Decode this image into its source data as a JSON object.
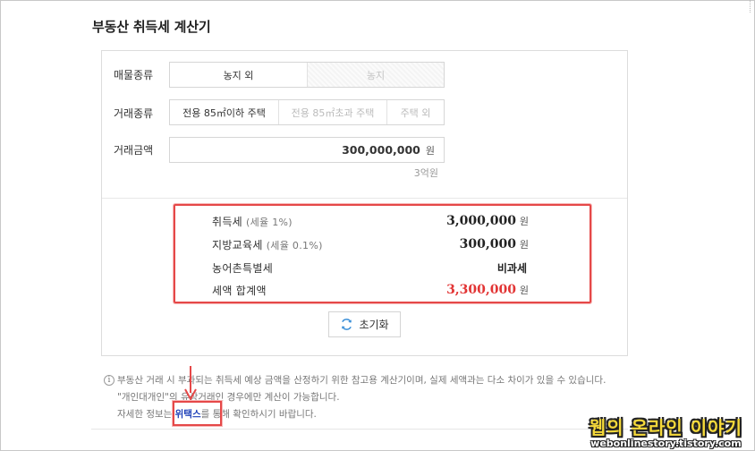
{
  "page": {
    "title": "부동산 취득세 계산기"
  },
  "form": {
    "property_type": {
      "label": "매물종류",
      "options": [
        "농지 외",
        "농지"
      ],
      "selected": "농지 외"
    },
    "transaction_type": {
      "label": "거래종류",
      "options": [
        "전용 85㎡이하 주택",
        "전용 85㎡초과 주택",
        "주택 외"
      ],
      "selected": "전용 85㎡이하 주택"
    },
    "amount": {
      "label": "거래금액",
      "value": "300,000,000",
      "unit": "원",
      "hint": "3억원"
    }
  },
  "results": {
    "acquisition_tax": {
      "label": "취득세",
      "rate": "(세율 1%)",
      "value": "3,000,000",
      "unit": "원"
    },
    "education_tax": {
      "label": "지방교육세",
      "rate": "(세율 0.1%)",
      "value": "300,000",
      "unit": "원"
    },
    "rural_tax": {
      "label": "농어촌특별세",
      "value": "비과세"
    },
    "total": {
      "label": "세액 합계액",
      "value": "3,300,000",
      "unit": "원"
    }
  },
  "reset_button": {
    "label": "초기화",
    "icon": "refresh-icon"
  },
  "notice": {
    "line1": "부동산 거래 시 부과되는 취득세 예상 금액을 산정하기 위한 참고용 계산기이며, 실제 세액과는 다소 차이가 있을 수 있습니다.",
    "line2": "\"개인대개인\"의 유상거래인 경우에만 계산이 가능합니다.",
    "line3_before": "자세한 정보는 ",
    "line3_link": "위택스",
    "line3_after": "를 통해 확인하시기 바랍니다."
  },
  "watermark": {
    "title": "웹의 온라인 이야기",
    "url": "webonlinestory.tistory.com"
  },
  "colors": {
    "accent_red": "#e54848",
    "total_red": "#e23434",
    "link_blue": "#1d3fb8",
    "watermark_yellow": "#f5d93a"
  }
}
